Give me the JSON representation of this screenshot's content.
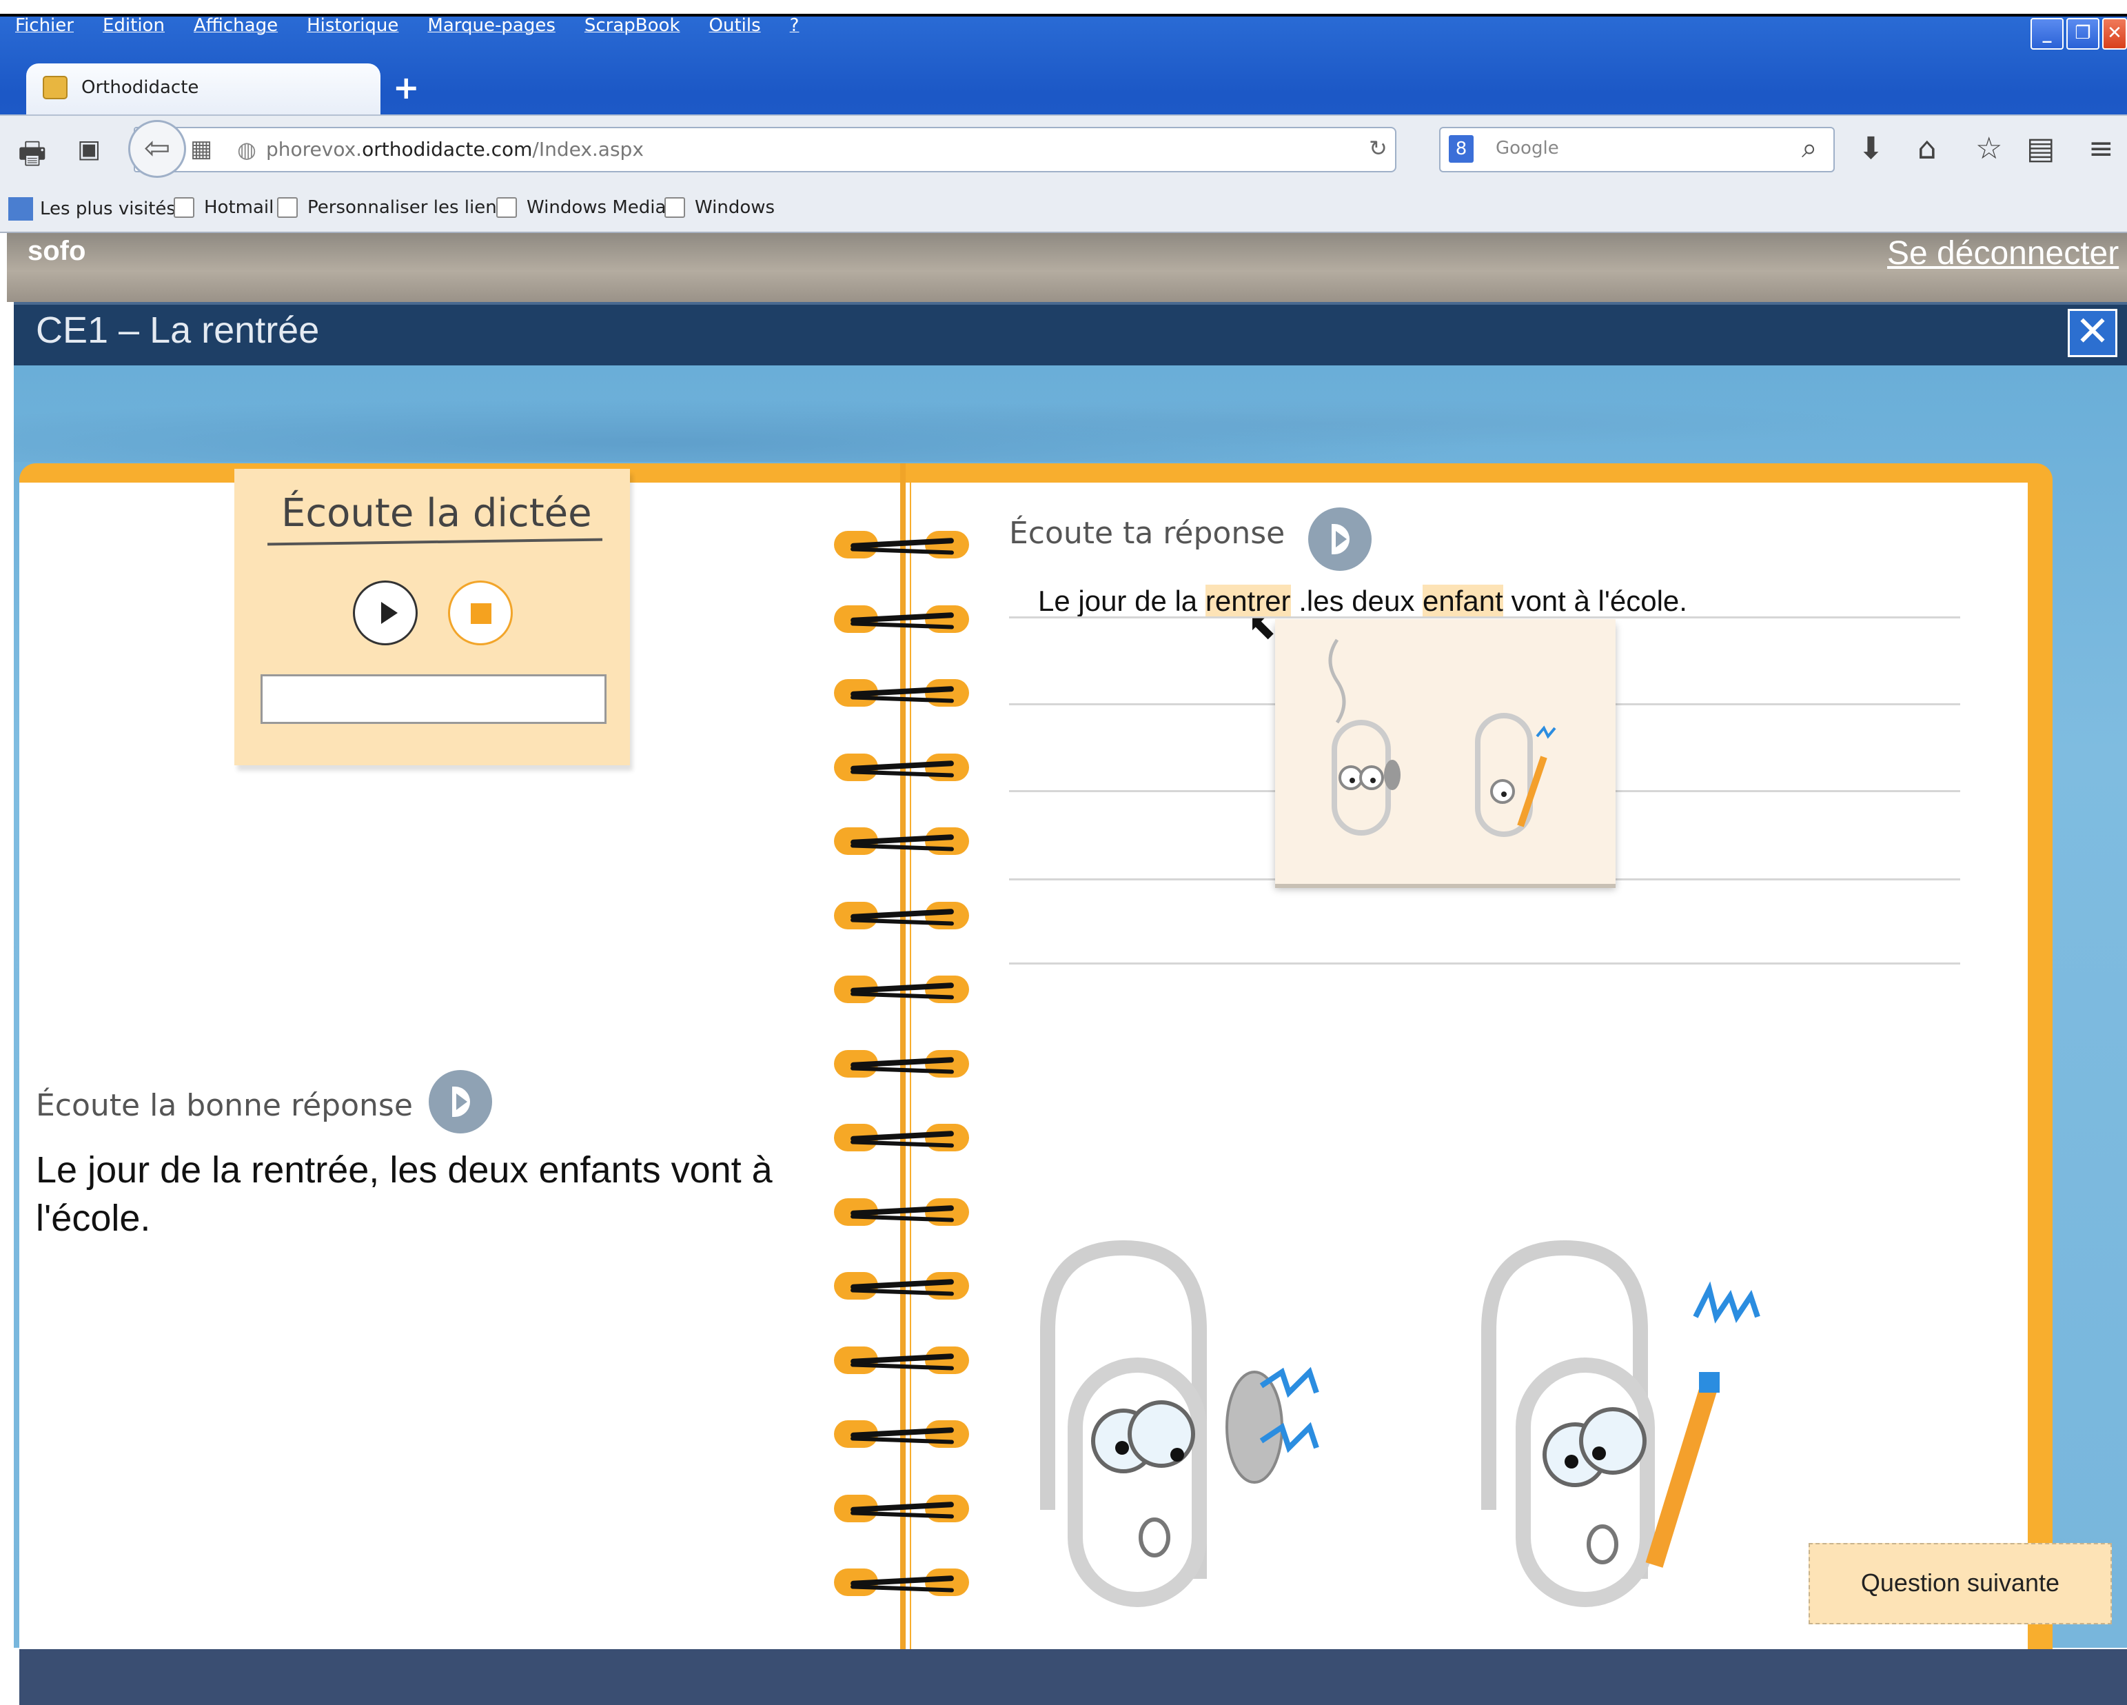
{
  "browser": {
    "menu": [
      "Fichier",
      "Edition",
      "Affichage",
      "Historique",
      "Marque-pages",
      "ScrapBook",
      "Outils",
      "?"
    ],
    "tab_title": "Orthodidacte",
    "new_tab": "+",
    "url_prefix": "phorevox.",
    "url_domain": "orthodidacte.com",
    "url_path": "/Index.aspx",
    "search_placeholder": "Google",
    "search_engine": "8",
    "bookmarks": [
      "Les plus visités",
      "Hotmail",
      "Personnaliser les liens",
      "Windows Media",
      "Windows"
    ]
  },
  "header": {
    "brand": "sofo",
    "logout": "Se déconnecter"
  },
  "lesson": {
    "title": "CE1 – La rentrée",
    "close": "✕"
  },
  "dictee": {
    "title": "Écoute la dictée",
    "input_value": ""
  },
  "response": {
    "label": "Écoute ta réponse",
    "parts": [
      "Le jour de la ",
      "rentrer",
      " .les deux ",
      "enfant",
      " vont à l'école."
    ]
  },
  "correction": {
    "label": "Écoute la bonne réponse",
    "text": "Le jour de la rentrée, les deux enfants vont à l'école."
  },
  "next_button": "Question suivante",
  "colors": {
    "accent": "#f8ae2e",
    "header_dark": "#1e3f66",
    "highlight": "#fde3b6"
  }
}
